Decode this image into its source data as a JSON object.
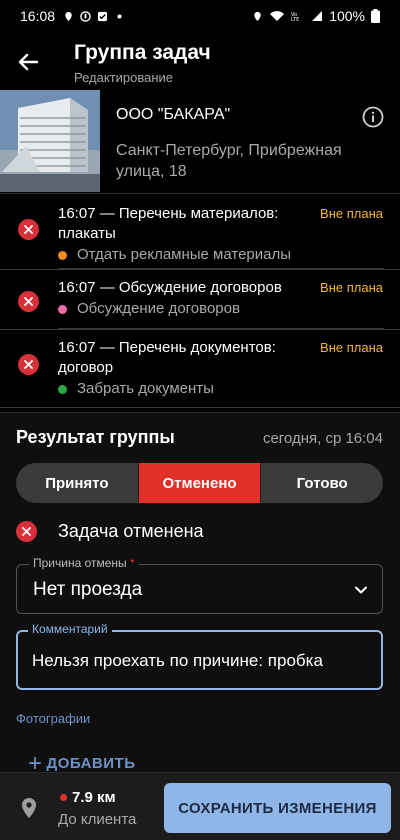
{
  "status_bar": {
    "time": "16:08",
    "battery": "100%",
    "icons_left": [
      "location-icon",
      "shield-icon",
      "checkbox-icon",
      "dot-icon"
    ],
    "icons_right": [
      "location-icon",
      "wifi-icon",
      "volte-icon",
      "signal-icon",
      "battery-icon"
    ]
  },
  "header": {
    "title": "Группа задач",
    "subtitle": "Редактирование"
  },
  "client": {
    "name": "ООО \"БАКАРА\"",
    "address": "Санкт-Петербург,  Прибрежная улица, 18"
  },
  "tasks": [
    {
      "title": "16:07 — Перечень материалов: плакаты",
      "badge": "Вне плана",
      "subtitle": "Отдать рекламные материалы",
      "dot_color": "#f08a24"
    },
    {
      "title": "16:07 — Обсуждение договоров",
      "badge": "Вне плана",
      "subtitle": "Обсуждение договоров",
      "dot_color": "#ef6ea8"
    },
    {
      "title": "16:07 — Перечень документов: договор",
      "badge": "Вне плана",
      "subtitle": "Забрать документы",
      "dot_color": "#2ea94a"
    }
  ],
  "result": {
    "title": "Результат группы",
    "time": "сегодня, ср 16:04",
    "options": [
      "Принято",
      "Отменено",
      "Готово"
    ],
    "selected": "Отменено",
    "status": "Задача отменена",
    "reason_label": "Причина отмены",
    "reason_required": "*",
    "reason_value": "Нет проезда",
    "comment_label": "Комментарий",
    "comment_value": "Нельзя проехать по причине: пробка",
    "photos_label": "Фотографии",
    "add_label": "ДОБАВИТЬ"
  },
  "footer": {
    "distance": "7.9 км",
    "distance_label": "До клиента",
    "save_label": "СОХРАНИТЬ ИЗМЕНЕНИЯ"
  },
  "colors": {
    "accent": "#8fb6e6",
    "danger": "#e13029",
    "warning": "#f5b62f"
  }
}
